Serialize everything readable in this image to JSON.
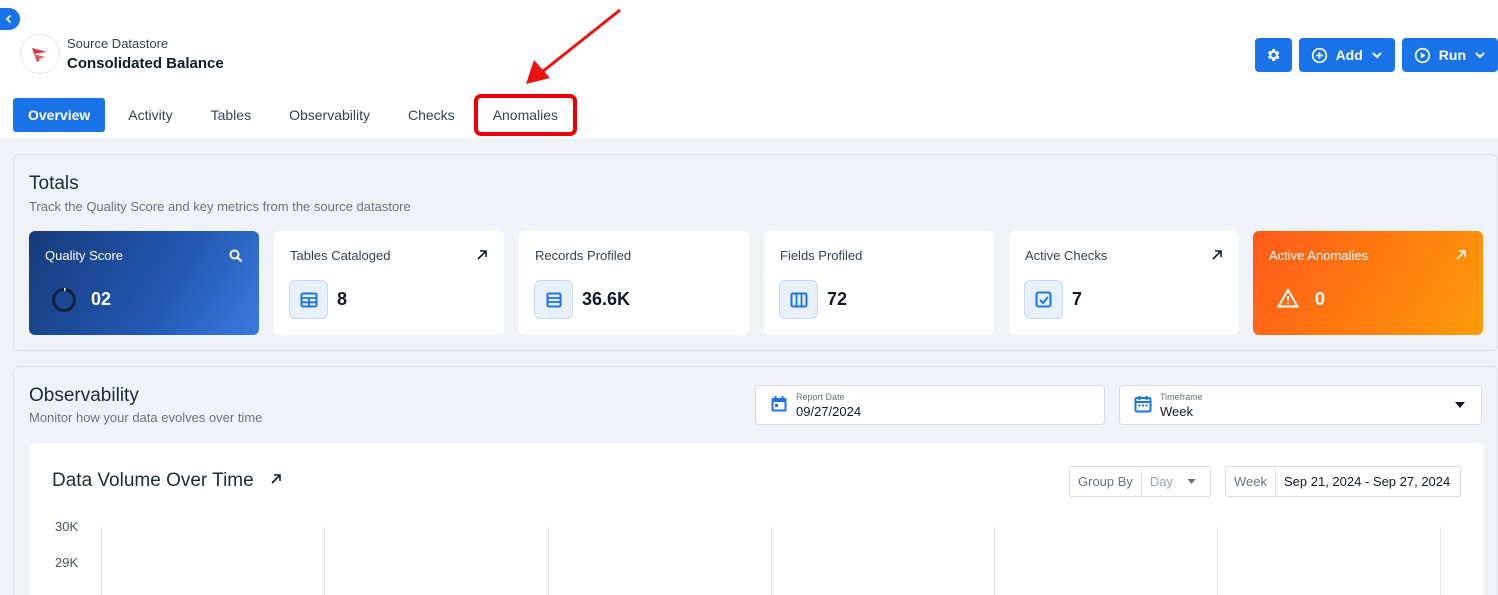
{
  "header": {
    "datastore_type": "Source Datastore",
    "datastore_name": "Consolidated Balance",
    "actions": {
      "add_label": "Add",
      "run_label": "Run"
    }
  },
  "tabs": [
    {
      "label": "Overview",
      "active": true
    },
    {
      "label": "Activity",
      "active": false
    },
    {
      "label": "Tables",
      "active": false
    },
    {
      "label": "Observability",
      "active": false
    },
    {
      "label": "Checks",
      "active": false
    },
    {
      "label": "Anomalies",
      "active": false,
      "highlighted": true
    }
  ],
  "totals": {
    "title": "Totals",
    "subtitle": "Track the Quality Score and key metrics from the source datastore",
    "cards": {
      "quality": {
        "label": "Quality Score",
        "value": "02"
      },
      "tables": {
        "label": "Tables Cataloged",
        "value": "8"
      },
      "records": {
        "label": "Records Profiled",
        "value": "36.6K"
      },
      "fields": {
        "label": "Fields Profiled",
        "value": "72"
      },
      "checks": {
        "label": "Active Checks",
        "value": "7"
      },
      "anomalies": {
        "label": "Active Anomalies",
        "value": "0"
      }
    }
  },
  "observability": {
    "title": "Observability",
    "subtitle": "Monitor how your data evolves over time",
    "report_date": {
      "label": "Report Date",
      "value": "09/27/2024"
    },
    "timeframe": {
      "label": "Timeframe",
      "value": "Week"
    },
    "chart_card": {
      "title": "Data Volume Over Time",
      "group_by": {
        "key": "Group By",
        "value": "Day"
      },
      "range": {
        "key": "Week",
        "value": "Sep 21, 2024 - Sep 27, 2024"
      }
    }
  },
  "chart_data": {
    "type": "bar",
    "title": "Data Volume Over Time",
    "y_ticks": [
      "30K",
      "29K"
    ],
    "categories": [],
    "values": []
  },
  "colors": {
    "primary": "#1a73e8",
    "highlight": "#ef0000",
    "anomaly_orange": "#ff7a10",
    "quality_navy": "#163a7a"
  }
}
